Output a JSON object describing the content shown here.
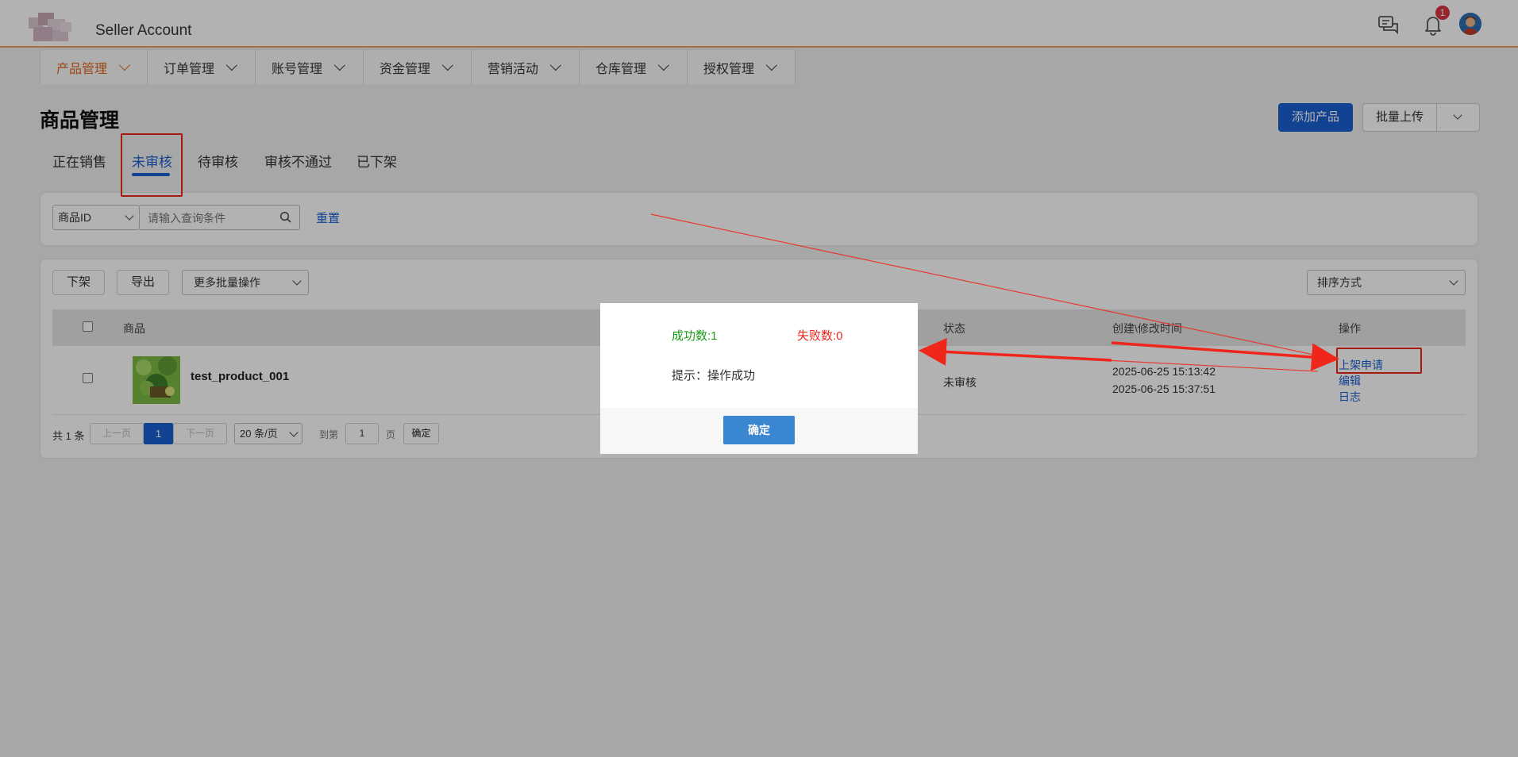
{
  "header": {
    "brand": "Seller Account",
    "notification_count": "1",
    "icons": [
      "chat-icon",
      "bell-icon",
      "avatar"
    ]
  },
  "nav": {
    "items": [
      {
        "label": "产品管理",
        "active": true
      },
      {
        "label": "订单管理"
      },
      {
        "label": "账号管理"
      },
      {
        "label": "资金管理"
      },
      {
        "label": "营销活动"
      },
      {
        "label": "仓库管理"
      },
      {
        "label": "授权管理"
      }
    ]
  },
  "page": {
    "title": "商品管理",
    "add_button": "添加产品",
    "bulk_upload": "批量上传"
  },
  "tabs": [
    {
      "label": "正在销售"
    },
    {
      "label": "未审核",
      "active": true
    },
    {
      "label": "待审核"
    },
    {
      "label": "审核不通过"
    },
    {
      "label": "已下架"
    }
  ],
  "search": {
    "field_select": "商品ID",
    "placeholder": "请输入查询条件",
    "reset": "重置"
  },
  "toolbar": {
    "delist": "下架",
    "export": "导出",
    "more_bulk": "更多批量操作",
    "sort": "排序方式"
  },
  "table": {
    "headers": {
      "product": "商品",
      "status": "状态",
      "time": "创建\\修改时间",
      "actions": "操作"
    },
    "rows": [
      {
        "name": "test_product_001",
        "status": "未审核",
        "created": "2025-06-25 15:13:42",
        "modified": "2025-06-25 15:37:51",
        "actions": [
          "上架申请",
          "编辑",
          "日志"
        ]
      }
    ]
  },
  "pager": {
    "total": "共 1 条",
    "prev": "上一页",
    "current": "1",
    "next": "下一页",
    "page_size": "20 条/页",
    "goto_label": "到第",
    "goto_value": "1",
    "page_unit": "页",
    "confirm": "确定"
  },
  "dialog": {
    "success": "成功数:1",
    "fail": "失败数:0",
    "message": "提示：操作成功",
    "ok": "确定"
  },
  "colors": {
    "primary": "#1a5fd1",
    "accent_orange": "#e0651a",
    "annotation_red": "#f0261a",
    "success_green": "#1a9a1a",
    "fail_red": "#e8261a",
    "dialog_button": "#3a86d0"
  }
}
